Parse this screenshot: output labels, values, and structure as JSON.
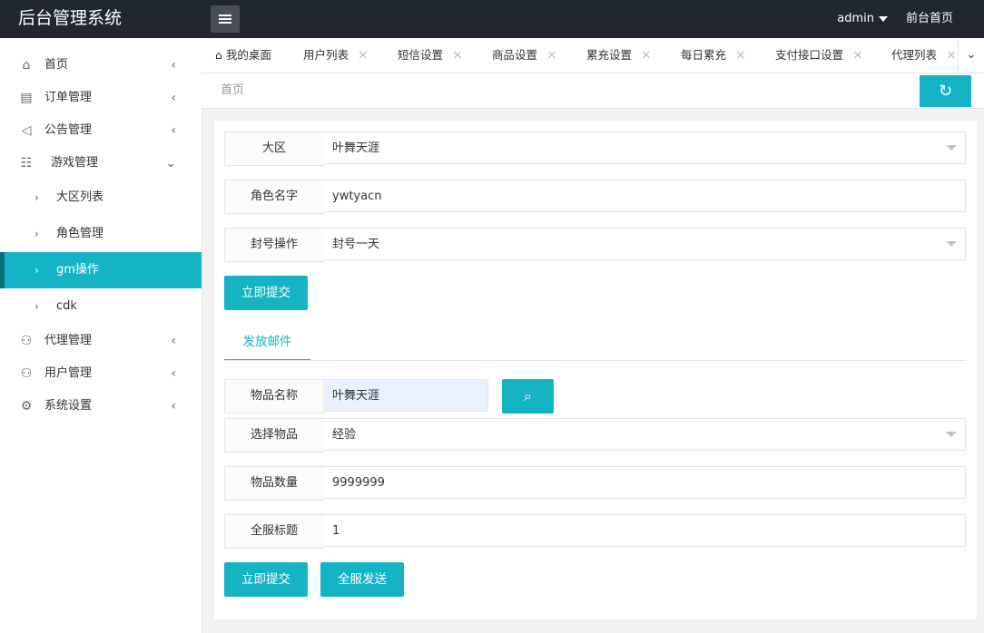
{
  "app": {
    "title": "后台管理系统"
  },
  "header": {
    "user": "admin",
    "front_link": "前台首页"
  },
  "sidebar": {
    "items": [
      {
        "label": "首页",
        "icon": "home-icon"
      },
      {
        "label": "订单管理",
        "icon": "order-icon"
      },
      {
        "label": "公告管理",
        "icon": "speaker-icon"
      },
      {
        "label": "游戏管理",
        "icon": "sitemap-icon"
      },
      {
        "label": "代理管理",
        "icon": "user-icon"
      },
      {
        "label": "用户管理",
        "icon": "user-icon"
      },
      {
        "label": "系统设置",
        "icon": "gear-icon"
      }
    ],
    "sub_items": [
      {
        "label": "大区列表"
      },
      {
        "label": "角色管理"
      },
      {
        "label": "gm操作",
        "active": true
      },
      {
        "label": "cdk"
      }
    ]
  },
  "tabs": [
    {
      "label": "我的桌面",
      "home": true
    },
    {
      "label": "用户列表"
    },
    {
      "label": "短信设置"
    },
    {
      "label": "商品设置"
    },
    {
      "label": "累充设置"
    },
    {
      "label": "每日累充"
    },
    {
      "label": "支付接口设置"
    },
    {
      "label": "代理列表"
    }
  ],
  "breadcrumb": {
    "text": "首页"
  },
  "form1": {
    "region_label": "大区",
    "region_value": "叶舞天涯",
    "role_label": "角色名字",
    "role_value": "ywtyacn",
    "ban_label": "封号操作",
    "ban_value": "封号一天",
    "submit": "立即提交"
  },
  "mail_tab": "发放邮件",
  "form2": {
    "item_name_label": "物品名称",
    "item_name_value": "叶舞天涯",
    "select_item_label": "选择物品",
    "select_item_value": "经验",
    "qty_label": "物品数量",
    "qty_value": "9999999",
    "title_label": "全服标题",
    "title_value": "1",
    "submit": "立即提交",
    "send_all": "全服发送"
  },
  "colors": {
    "accent": "#15b4c5",
    "topbar": "#23262e"
  }
}
